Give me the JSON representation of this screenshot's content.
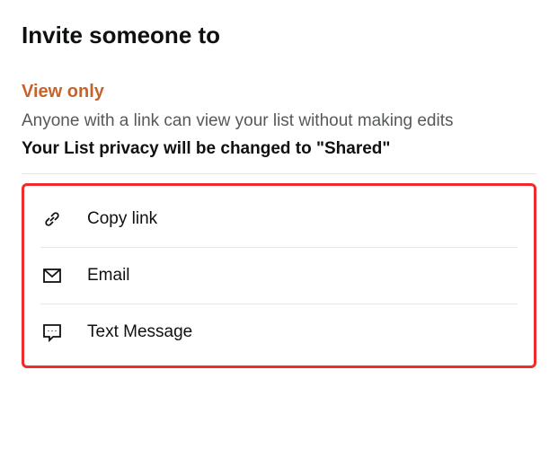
{
  "header": {
    "title": "Invite someone to"
  },
  "section": {
    "subtitle": "View only",
    "description": "Anyone with a link can view your list without making edits",
    "privacy_notice": "Your List privacy will be changed to \"Shared\""
  },
  "share_options": [
    {
      "label": "Copy link"
    },
    {
      "label": "Email"
    },
    {
      "label": "Text Message"
    }
  ]
}
